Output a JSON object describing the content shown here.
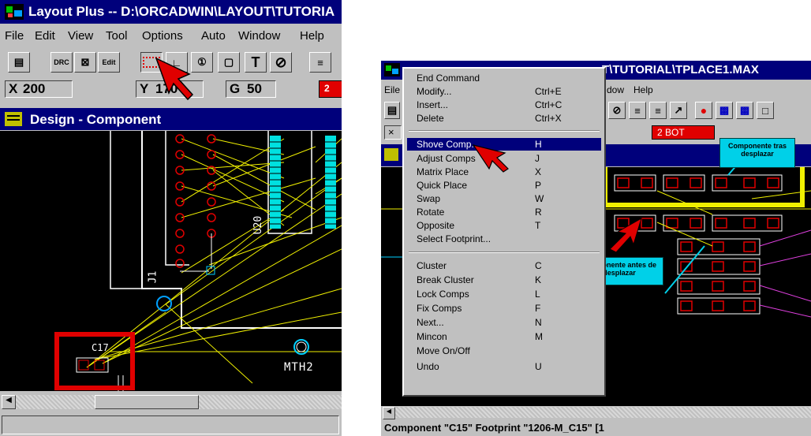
{
  "left": {
    "title": "Layout Plus -- D:\\ORCADWIN\\LAYOUT\\TUTORIA",
    "menu": [
      "File",
      "Edit",
      "View",
      "Tool",
      "Options",
      "Auto",
      "Window",
      "Help"
    ],
    "toolbar": {
      "drc": "DRC",
      "edit": "Edit"
    },
    "coords": {
      "x_label": "X",
      "x_value": "200",
      "y_label": "Y",
      "y_value": "170",
      "g_label": "G",
      "g_value": "50",
      "layer": "2"
    },
    "child_title": "Design - Component",
    "canvas_labels": {
      "j1": "J1",
      "u20": "U20",
      "c17": "C17",
      "mth2": "MTH2"
    }
  },
  "right": {
    "title": "T\\TUTORIAL\\TPLACE1.MAX",
    "menu": [
      "Eile",
      "dow",
      "Help"
    ],
    "layer": "2  BOT",
    "status": "Component \"C15\" Footprint \"1206-M_C15\"   [1"
  },
  "popup_menu": [
    {
      "label": "End Command",
      "key": ""
    },
    {
      "label": "Modify...",
      "key": "Ctrl+E"
    },
    {
      "label": "Insert...",
      "key": "Ctrl+C"
    },
    {
      "label": "Delete",
      "key": "Ctrl+X"
    },
    {
      "label": "Shove Comp.",
      "key": "H"
    },
    {
      "label": "Adjust Comps",
      "key": "J"
    },
    {
      "label": "Matrix Place",
      "key": "X"
    },
    {
      "label": "Quick Place",
      "key": "P"
    },
    {
      "label": "Swap",
      "key": "W"
    },
    {
      "label": "Rotate",
      "key": "R"
    },
    {
      "label": "Opposite",
      "key": "T"
    },
    {
      "label": "Select Footprint...",
      "key": ""
    },
    {
      "label": "Cluster",
      "key": "C"
    },
    {
      "label": "Break Cluster",
      "key": "K"
    },
    {
      "label": "Lock Comps",
      "key": "L"
    },
    {
      "label": "Fix Comps",
      "key": "F"
    },
    {
      "label": "Next...",
      "key": "N"
    },
    {
      "label": "Mincon",
      "key": "M"
    },
    {
      "label": "Move On/Off",
      "key": ""
    },
    {
      "label": "Undo",
      "key": "U"
    }
  ],
  "callouts": {
    "after": "Componente tras desplazar",
    "before": "Componente antes de desplazar"
  },
  "colors": {
    "titlebar": "#00007b",
    "chrome": "#c0c0c0",
    "canvas": "#000000",
    "highlight_red": "#e00000",
    "highlight_yellow": "#f0f000",
    "callout": "#00d0e8"
  }
}
